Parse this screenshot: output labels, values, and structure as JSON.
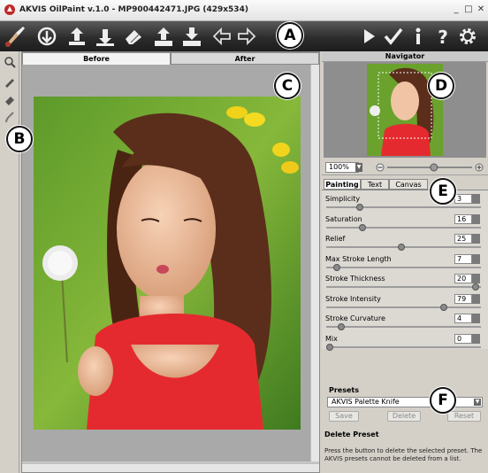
{
  "window": {
    "title": "AKVIS OilPaint v.1.0 - MP900442471.JPG (429x534)",
    "minimize": "_",
    "maximize": "□",
    "close": "✕"
  },
  "callouts": {
    "toolbar": "A",
    "toolstrip": "B",
    "workspace": "C",
    "navigator": "D",
    "settings": "E",
    "presets": "F"
  },
  "toolbar": {
    "items": [
      "brush-logo-icon",
      "open-icon",
      "save-icon",
      "print-icon",
      "eraser-icon",
      "upload-icon",
      "download-icon",
      "back-arrow-icon",
      "forward-arrow-icon",
      "run-icon",
      "apply-icon",
      "info-icon",
      "help-icon",
      "settings-icon"
    ]
  },
  "workspace": {
    "tab_before": "Before",
    "tab_after": "After"
  },
  "navigator": {
    "title": "Navigator",
    "zoom_value": "100%",
    "zoom_level_fraction": 0.55
  },
  "settings": {
    "tabs": [
      "Painting",
      "Text",
      "Canvas"
    ],
    "active_tab": "Painting",
    "params": [
      {
        "label": "Simplicity",
        "value": "3",
        "fraction": 0.2
      },
      {
        "label": "Saturation",
        "value": "16",
        "fraction": 0.22
      },
      {
        "label": "Relief",
        "value": "25",
        "fraction": 0.48
      },
      {
        "label": "Max Stroke Length",
        "value": "7",
        "fraction": 0.05
      },
      {
        "label": "Stroke Thickness",
        "value": "20",
        "fraction": 0.98
      },
      {
        "label": "Stroke Intensity",
        "value": "79",
        "fraction": 0.77
      },
      {
        "label": "Stroke Curvature",
        "value": "4",
        "fraction": 0.08
      },
      {
        "label": "Mix",
        "value": "0",
        "fraction": 0.0
      }
    ]
  },
  "presets": {
    "label": "Presets",
    "selected": "AKVIS Palette Knife",
    "save": "Save",
    "delete": "Delete",
    "reset": "Reset"
  },
  "help": {
    "title": "Delete Preset",
    "text": "Press the button to delete the selected preset. The AKVIS presets cannot be deleted from a list."
  },
  "colors": {
    "toolbar_bg": "#2c2c2c",
    "accent": "#b02020"
  }
}
